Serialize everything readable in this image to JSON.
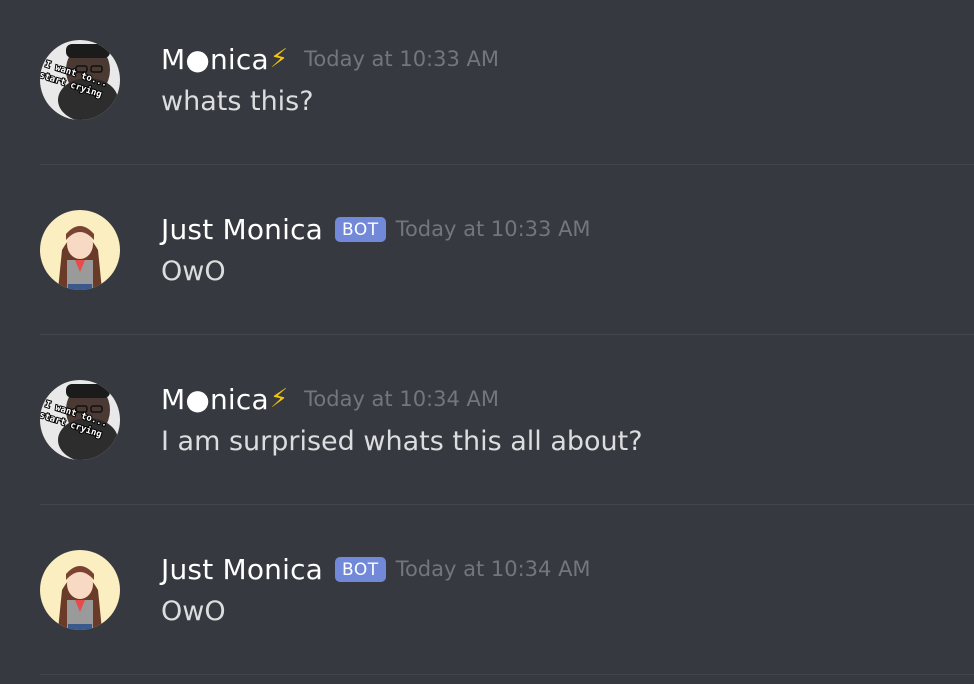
{
  "messages": [
    {
      "author": "M●nica",
      "author_badge_icon": "lightning-bolt",
      "author_badge_glyph": "⚡",
      "is_bot": false,
      "timestamp": "Today at 10:33 AM",
      "content": "whats this?",
      "avatar_caption": "I want to... start crying"
    },
    {
      "author": "Just Monica",
      "is_bot": true,
      "bot_label": "BOT",
      "timestamp": "Today at 10:33 AM",
      "content": "OwO"
    },
    {
      "author": "M●nica",
      "author_badge_icon": "lightning-bolt",
      "author_badge_glyph": "⚡",
      "is_bot": false,
      "timestamp": "Today at 10:34 AM",
      "content": "I am surprised whats this all about?",
      "avatar_caption": "I want to... start crying"
    },
    {
      "author": "Just Monica",
      "is_bot": true,
      "bot_label": "BOT",
      "timestamp": "Today at 10:34 AM",
      "content": "OwO"
    }
  ],
  "colors": {
    "background": "#36393f",
    "username": "#ffffff",
    "message_text": "#dcddde",
    "timestamp": "#72767d",
    "bot_tag": "#7289da",
    "divider": "#42454a"
  }
}
